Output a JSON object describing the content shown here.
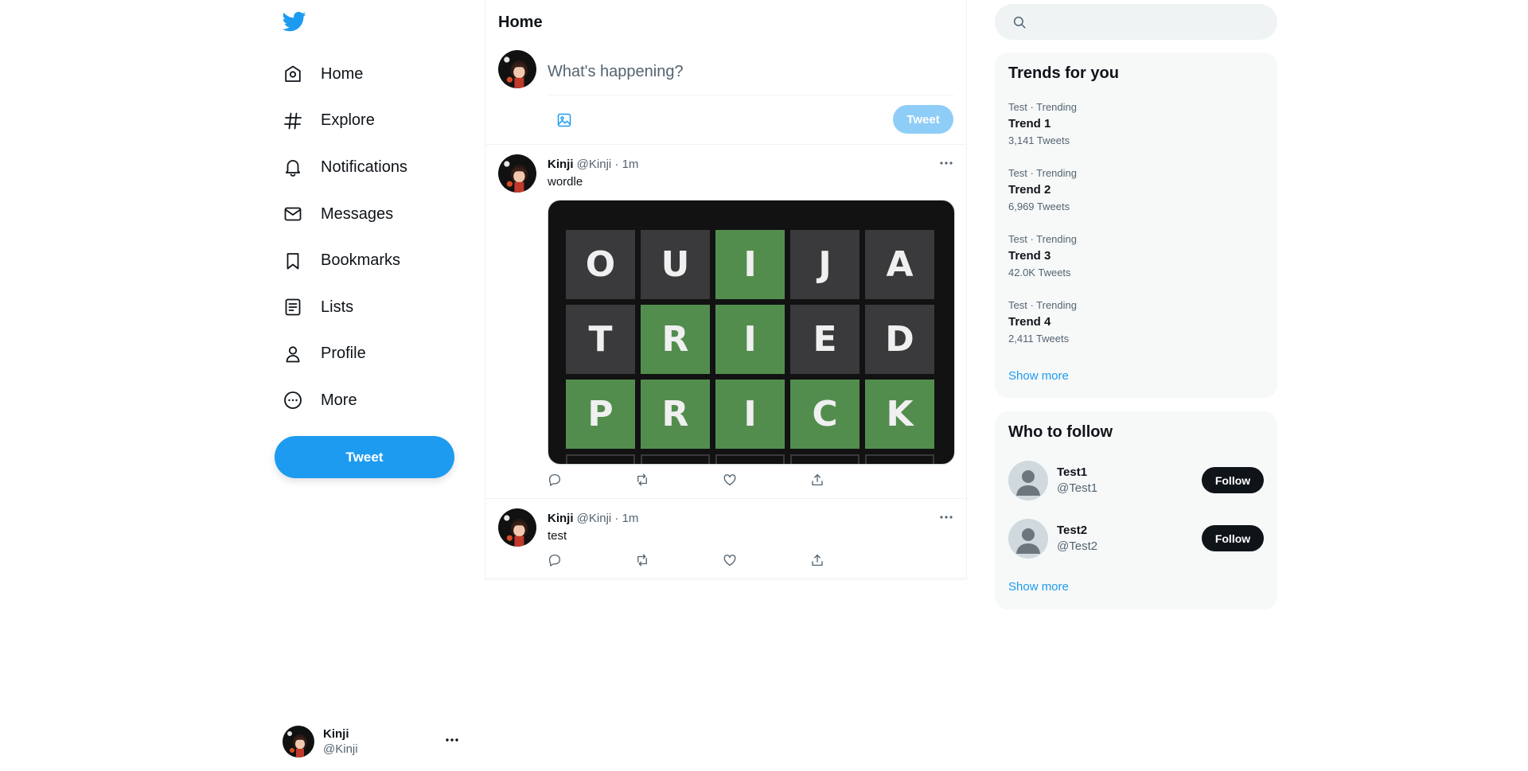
{
  "sidebar": {
    "logo": "twitter-bird-icon",
    "nav": [
      {
        "label": "Home",
        "icon": "home-icon"
      },
      {
        "label": "Explore",
        "icon": "hashtag-icon"
      },
      {
        "label": "Notifications",
        "icon": "bell-icon"
      },
      {
        "label": "Messages",
        "icon": "envelope-icon"
      },
      {
        "label": "Bookmarks",
        "icon": "bookmark-icon"
      },
      {
        "label": "Lists",
        "icon": "list-icon"
      },
      {
        "label": "Profile",
        "icon": "person-icon"
      },
      {
        "label": "More",
        "icon": "more-circle-icon"
      }
    ],
    "tweet_button": "Tweet",
    "account": {
      "name": "Kinji",
      "handle": "@Kinji"
    }
  },
  "timeline": {
    "title": "Home",
    "compose": {
      "placeholder": "What's happening?",
      "tweet_button": "Tweet"
    },
    "tweets": [
      {
        "name": "Kinji",
        "handle": "@Kinji",
        "time": "1m",
        "text": "wordle",
        "media": {
          "type": "wordle-board",
          "rows": [
            {
              "letters": [
                "O",
                "U",
                "I",
                "J",
                "A"
              ],
              "states": [
                "absent",
                "absent",
                "correct",
                "absent",
                "absent"
              ]
            },
            {
              "letters": [
                "T",
                "R",
                "I",
                "E",
                "D"
              ],
              "states": [
                "absent",
                "correct",
                "correct",
                "absent",
                "absent"
              ]
            },
            {
              "letters": [
                "P",
                "R",
                "I",
                "C",
                "K"
              ],
              "states": [
                "correct",
                "correct",
                "correct",
                "correct",
                "correct"
              ]
            }
          ]
        }
      },
      {
        "name": "Kinji",
        "handle": "@Kinji",
        "time": "1m",
        "text": "test"
      }
    ]
  },
  "right": {
    "search": {
      "placeholder": ""
    },
    "trends": {
      "title": "Trends for you",
      "items": [
        {
          "context": "Test · Trending",
          "title": "Trend 1",
          "count": "3,141 Tweets"
        },
        {
          "context": "Test · Trending",
          "title": "Trend 2",
          "count": "6,969 Tweets"
        },
        {
          "context": "Test · Trending",
          "title": "Trend 3",
          "count": "42.0K Tweets"
        },
        {
          "context": "Test · Trending",
          "title": "Trend 4",
          "count": "2,411 Tweets"
        }
      ],
      "show_more": "Show more"
    },
    "who_to_follow": {
      "title": "Who to follow",
      "users": [
        {
          "name": "Test1",
          "handle": "@Test1",
          "button": "Follow"
        },
        {
          "name": "Test2",
          "handle": "@Test2",
          "button": "Follow"
        }
      ],
      "show_more": "Show more"
    }
  },
  "colors": {
    "accent": "#1d9bf0",
    "wordle_correct": "#538d4e",
    "wordle_absent": "#3a3a3c"
  }
}
